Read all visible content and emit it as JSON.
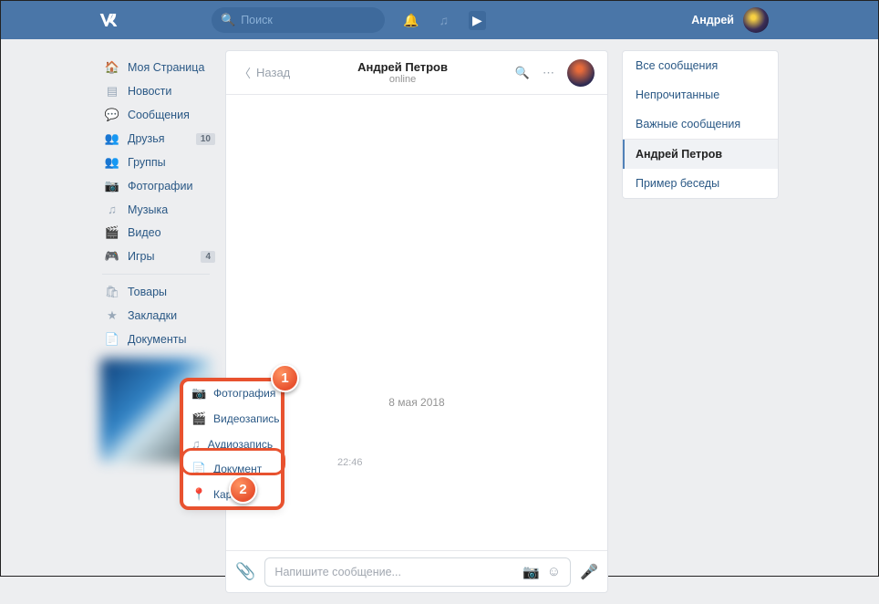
{
  "header": {
    "search_placeholder": "Поиск",
    "username": "Андрей"
  },
  "sidebar": {
    "items": [
      {
        "icon": "🏠",
        "label": "Моя Страница"
      },
      {
        "icon": "▤",
        "label": "Новости"
      },
      {
        "icon": "💬",
        "label": "Сообщения"
      },
      {
        "icon": "👥",
        "label": "Друзья",
        "badge": "10"
      },
      {
        "icon": "👥",
        "label": "Группы"
      },
      {
        "icon": "📷",
        "label": "Фотографии"
      },
      {
        "icon": "♫",
        "label": "Музыка"
      },
      {
        "icon": "🎬",
        "label": "Видео"
      },
      {
        "icon": "🎮",
        "label": "Игры",
        "badge": "4"
      }
    ],
    "items2": [
      {
        "icon": "🛍",
        "label": "Товары"
      },
      {
        "icon": "★",
        "label": "Закладки"
      },
      {
        "icon": "📄",
        "label": "Документы"
      }
    ]
  },
  "chat": {
    "back_label": "Назад",
    "peer_name": "Андрей Петров",
    "peer_status": "online",
    "date_divider": "8 мая 2018",
    "msg_time": "22:46",
    "input_placeholder": "Напишите сообщение..."
  },
  "rightpane": {
    "items": [
      {
        "label": "Все сообщения"
      },
      {
        "label": "Непрочитанные"
      },
      {
        "label": "Важные сообщения"
      },
      {
        "label": "Андрей Петров",
        "active": true
      },
      {
        "label": "Пример беседы"
      }
    ]
  },
  "attach_menu": {
    "items": [
      {
        "icon": "📷",
        "label": "Фотография"
      },
      {
        "icon": "🎬",
        "label": "Видеозапись"
      },
      {
        "icon": "♫",
        "label": "Аудиозапись"
      },
      {
        "icon": "📄",
        "label": "Документ"
      },
      {
        "icon": "📍",
        "label": "Карта"
      }
    ]
  },
  "callouts": {
    "c1": "1",
    "c2": "2"
  }
}
